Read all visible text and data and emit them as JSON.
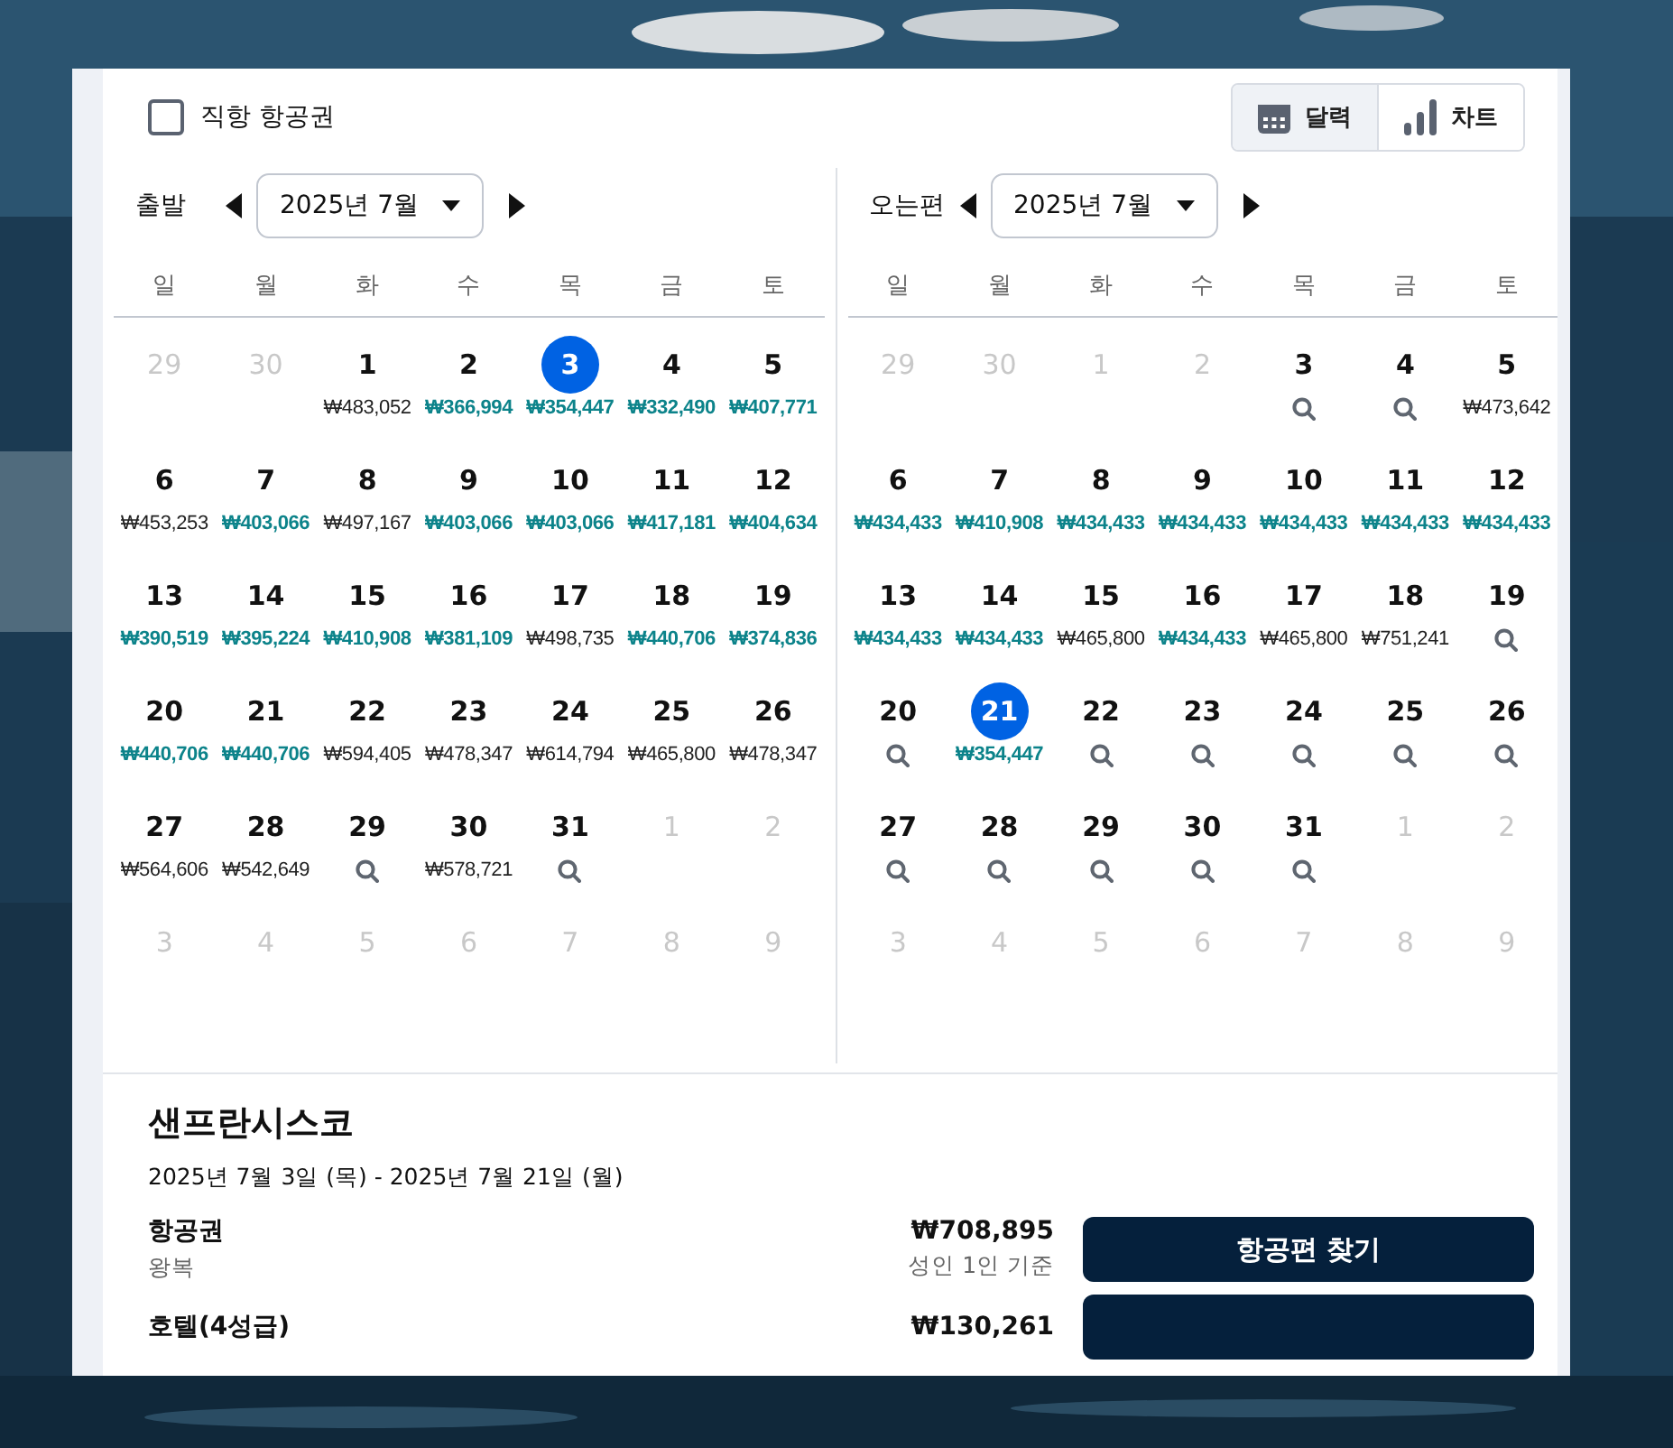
{
  "direct_flight": {
    "label": "직항 항공권",
    "checked": false
  },
  "views": [
    {
      "label": "달력",
      "selected": true
    },
    {
      "label": "차트",
      "selected": false
    }
  ],
  "calendars": [
    {
      "label": "출발",
      "month": "2025년 7월",
      "weekdays": [
        "일",
        "월",
        "화",
        "수",
        "목",
        "금",
        "토"
      ],
      "days": [
        {
          "day": "29",
          "muted": true,
          "selected": false,
          "kind": "none"
        },
        {
          "day": "30",
          "muted": true,
          "selected": false,
          "kind": "none"
        },
        {
          "day": "1",
          "muted": false,
          "selected": false,
          "kind": "price",
          "price": "₩483,052",
          "cheap": false
        },
        {
          "day": "2",
          "muted": false,
          "selected": false,
          "kind": "price",
          "price": "₩366,994",
          "cheap": true
        },
        {
          "day": "3",
          "muted": false,
          "selected": true,
          "kind": "price",
          "price": "₩354,447",
          "cheap": true
        },
        {
          "day": "4",
          "muted": false,
          "selected": false,
          "kind": "price",
          "price": "₩332,490",
          "cheap": true
        },
        {
          "day": "5",
          "muted": false,
          "selected": false,
          "kind": "price",
          "price": "₩407,771",
          "cheap": true
        },
        {
          "day": "6",
          "muted": false,
          "selected": false,
          "kind": "price",
          "price": "₩453,253",
          "cheap": false
        },
        {
          "day": "7",
          "muted": false,
          "selected": false,
          "kind": "price",
          "price": "₩403,066",
          "cheap": true
        },
        {
          "day": "8",
          "muted": false,
          "selected": false,
          "kind": "price",
          "price": "₩497,167",
          "cheap": false
        },
        {
          "day": "9",
          "muted": false,
          "selected": false,
          "kind": "price",
          "price": "₩403,066",
          "cheap": true
        },
        {
          "day": "10",
          "muted": false,
          "selected": false,
          "kind": "price",
          "price": "₩403,066",
          "cheap": true
        },
        {
          "day": "11",
          "muted": false,
          "selected": false,
          "kind": "price",
          "price": "₩417,181",
          "cheap": true
        },
        {
          "day": "12",
          "muted": false,
          "selected": false,
          "kind": "price",
          "price": "₩404,634",
          "cheap": true
        },
        {
          "day": "13",
          "muted": false,
          "selected": false,
          "kind": "price",
          "price": "₩390,519",
          "cheap": true
        },
        {
          "day": "14",
          "muted": false,
          "selected": false,
          "kind": "price",
          "price": "₩395,224",
          "cheap": true
        },
        {
          "day": "15",
          "muted": false,
          "selected": false,
          "kind": "price",
          "price": "₩410,908",
          "cheap": true
        },
        {
          "day": "16",
          "muted": false,
          "selected": false,
          "kind": "price",
          "price": "₩381,109",
          "cheap": true
        },
        {
          "day": "17",
          "muted": false,
          "selected": false,
          "kind": "price",
          "price": "₩498,735",
          "cheap": false
        },
        {
          "day": "18",
          "muted": false,
          "selected": false,
          "kind": "price",
          "price": "₩440,706",
          "cheap": true
        },
        {
          "day": "19",
          "muted": false,
          "selected": false,
          "kind": "price",
          "price": "₩374,836",
          "cheap": true
        },
        {
          "day": "20",
          "muted": false,
          "selected": false,
          "kind": "price",
          "price": "₩440,706",
          "cheap": true
        },
        {
          "day": "21",
          "muted": false,
          "selected": false,
          "kind": "price",
          "price": "₩440,706",
          "cheap": true
        },
        {
          "day": "22",
          "muted": false,
          "selected": false,
          "kind": "price",
          "price": "₩594,405",
          "cheap": false
        },
        {
          "day": "23",
          "muted": false,
          "selected": false,
          "kind": "price",
          "price": "₩478,347",
          "cheap": false
        },
        {
          "day": "24",
          "muted": false,
          "selected": false,
          "kind": "price",
          "price": "₩614,794",
          "cheap": false
        },
        {
          "day": "25",
          "muted": false,
          "selected": false,
          "kind": "price",
          "price": "₩465,800",
          "cheap": false
        },
        {
          "day": "26",
          "muted": false,
          "selected": false,
          "kind": "price",
          "price": "₩478,347",
          "cheap": false
        },
        {
          "day": "27",
          "muted": false,
          "selected": false,
          "kind": "price",
          "price": "₩564,606",
          "cheap": false
        },
        {
          "day": "28",
          "muted": false,
          "selected": false,
          "kind": "price",
          "price": "₩542,649",
          "cheap": false
        },
        {
          "day": "29",
          "muted": false,
          "selected": false,
          "kind": "search"
        },
        {
          "day": "30",
          "muted": false,
          "selected": false,
          "kind": "price",
          "price": "₩578,721",
          "cheap": false
        },
        {
          "day": "31",
          "muted": false,
          "selected": false,
          "kind": "search"
        },
        {
          "day": "1",
          "muted": true,
          "selected": false,
          "kind": "none"
        },
        {
          "day": "2",
          "muted": true,
          "selected": false,
          "kind": "none"
        },
        {
          "day": "3",
          "muted": true,
          "selected": false,
          "kind": "none"
        },
        {
          "day": "4",
          "muted": true,
          "selected": false,
          "kind": "none"
        },
        {
          "day": "5",
          "muted": true,
          "selected": false,
          "kind": "none"
        },
        {
          "day": "6",
          "muted": true,
          "selected": false,
          "kind": "none"
        },
        {
          "day": "7",
          "muted": true,
          "selected": false,
          "kind": "none"
        },
        {
          "day": "8",
          "muted": true,
          "selected": false,
          "kind": "none"
        },
        {
          "day": "9",
          "muted": true,
          "selected": false,
          "kind": "none"
        }
      ]
    },
    {
      "label": "오는편",
      "month": "2025년 7월",
      "weekdays": [
        "일",
        "월",
        "화",
        "수",
        "목",
        "금",
        "토"
      ],
      "days": [
        {
          "day": "29",
          "muted": true,
          "selected": false,
          "kind": "none"
        },
        {
          "day": "30",
          "muted": true,
          "selected": false,
          "kind": "none"
        },
        {
          "day": "1",
          "muted": true,
          "selected": false,
          "kind": "none"
        },
        {
          "day": "2",
          "muted": true,
          "selected": false,
          "kind": "none"
        },
        {
          "day": "3",
          "muted": false,
          "selected": false,
          "kind": "search"
        },
        {
          "day": "4",
          "muted": false,
          "selected": false,
          "kind": "search"
        },
        {
          "day": "5",
          "muted": false,
          "selected": false,
          "kind": "price",
          "price": "₩473,642",
          "cheap": false
        },
        {
          "day": "6",
          "muted": false,
          "selected": false,
          "kind": "price",
          "price": "₩434,433",
          "cheap": true
        },
        {
          "day": "7",
          "muted": false,
          "selected": false,
          "kind": "price",
          "price": "₩410,908",
          "cheap": true
        },
        {
          "day": "8",
          "muted": false,
          "selected": false,
          "kind": "price",
          "price": "₩434,433",
          "cheap": true
        },
        {
          "day": "9",
          "muted": false,
          "selected": false,
          "kind": "price",
          "price": "₩434,433",
          "cheap": true
        },
        {
          "day": "10",
          "muted": false,
          "selected": false,
          "kind": "price",
          "price": "₩434,433",
          "cheap": true
        },
        {
          "day": "11",
          "muted": false,
          "selected": false,
          "kind": "price",
          "price": "₩434,433",
          "cheap": true
        },
        {
          "day": "12",
          "muted": false,
          "selected": false,
          "kind": "price",
          "price": "₩434,433",
          "cheap": true
        },
        {
          "day": "13",
          "muted": false,
          "selected": false,
          "kind": "price",
          "price": "₩434,433",
          "cheap": true
        },
        {
          "day": "14",
          "muted": false,
          "selected": false,
          "kind": "price",
          "price": "₩434,433",
          "cheap": true
        },
        {
          "day": "15",
          "muted": false,
          "selected": false,
          "kind": "price",
          "price": "₩465,800",
          "cheap": false
        },
        {
          "day": "16",
          "muted": false,
          "selected": false,
          "kind": "price",
          "price": "₩434,433",
          "cheap": true
        },
        {
          "day": "17",
          "muted": false,
          "selected": false,
          "kind": "price",
          "price": "₩465,800",
          "cheap": false
        },
        {
          "day": "18",
          "muted": false,
          "selected": false,
          "kind": "price",
          "price": "₩751,241",
          "cheap": false
        },
        {
          "day": "19",
          "muted": false,
          "selected": false,
          "kind": "search"
        },
        {
          "day": "20",
          "muted": false,
          "selected": false,
          "kind": "search"
        },
        {
          "day": "21",
          "muted": false,
          "selected": true,
          "kind": "price",
          "price": "₩354,447",
          "cheap": true
        },
        {
          "day": "22",
          "muted": false,
          "selected": false,
          "kind": "search"
        },
        {
          "day": "23",
          "muted": false,
          "selected": false,
          "kind": "search"
        },
        {
          "day": "24",
          "muted": false,
          "selected": false,
          "kind": "search"
        },
        {
          "day": "25",
          "muted": false,
          "selected": false,
          "kind": "search"
        },
        {
          "day": "26",
          "muted": false,
          "selected": false,
          "kind": "search"
        },
        {
          "day": "27",
          "muted": false,
          "selected": false,
          "kind": "search"
        },
        {
          "day": "28",
          "muted": false,
          "selected": false,
          "kind": "search"
        },
        {
          "day": "29",
          "muted": false,
          "selected": false,
          "kind": "search"
        },
        {
          "day": "30",
          "muted": false,
          "selected": false,
          "kind": "search"
        },
        {
          "day": "31",
          "muted": false,
          "selected": false,
          "kind": "search"
        },
        {
          "day": "1",
          "muted": true,
          "selected": false,
          "kind": "none"
        },
        {
          "day": "2",
          "muted": true,
          "selected": false,
          "kind": "none"
        },
        {
          "day": "3",
          "muted": true,
          "selected": false,
          "kind": "none"
        },
        {
          "day": "4",
          "muted": true,
          "selected": false,
          "kind": "none"
        },
        {
          "day": "5",
          "muted": true,
          "selected": false,
          "kind": "none"
        },
        {
          "day": "6",
          "muted": true,
          "selected": false,
          "kind": "none"
        },
        {
          "day": "7",
          "muted": true,
          "selected": false,
          "kind": "none"
        },
        {
          "day": "8",
          "muted": true,
          "selected": false,
          "kind": "none"
        },
        {
          "day": "9",
          "muted": true,
          "selected": false,
          "kind": "none"
        }
      ]
    }
  ],
  "summary": {
    "city": "샌프란시스코",
    "dates": "2025년 7월 3일 (목) - 2025년 7월 21일 (월)",
    "items": [
      {
        "label": "항공권",
        "sub": "왕복",
        "price": "₩708,895",
        "note": "성인 1인 기준",
        "button": "항공편 찾기"
      },
      {
        "label": "호텔(4성급)",
        "price": "₩130,261"
      }
    ]
  }
}
